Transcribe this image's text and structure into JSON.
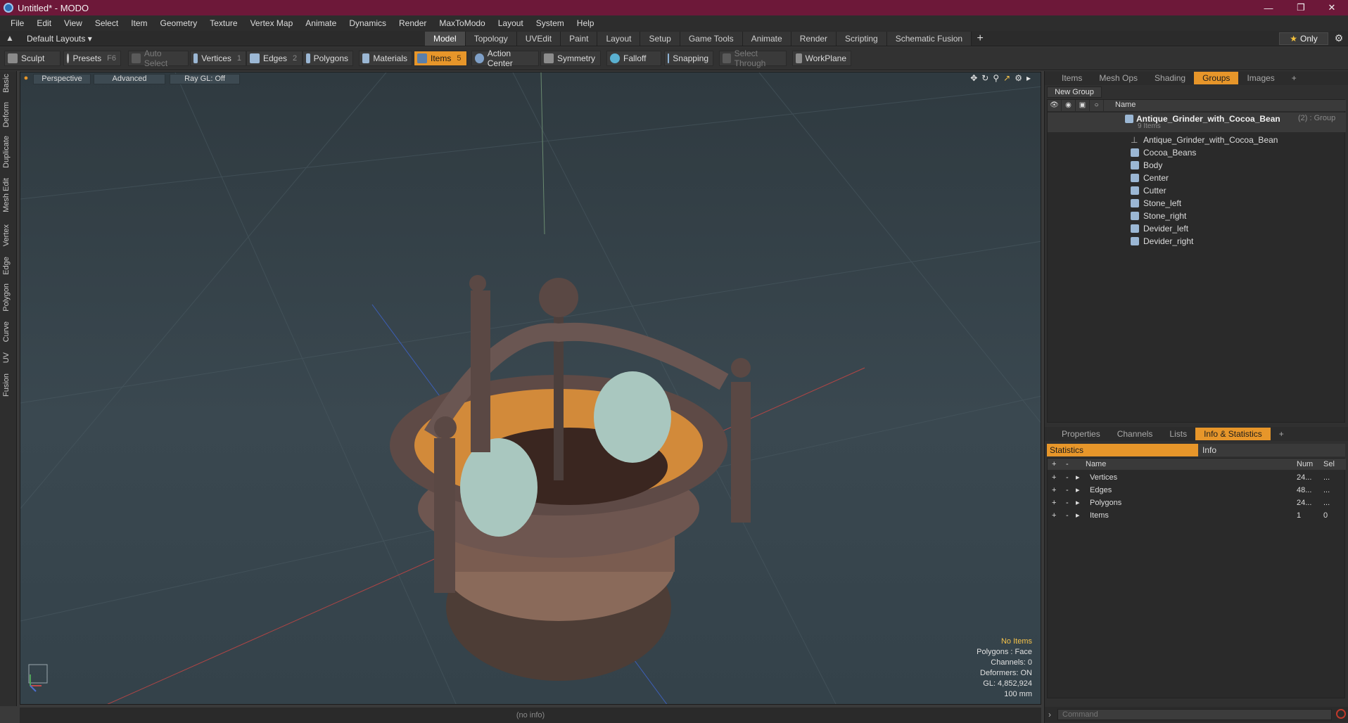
{
  "window": {
    "title": "Untitled* - MODO"
  },
  "menu": [
    "File",
    "Edit",
    "View",
    "Select",
    "Item",
    "Geometry",
    "Texture",
    "Vertex Map",
    "Animate",
    "Dynamics",
    "Render",
    "MaxToModo",
    "Layout",
    "System",
    "Help"
  ],
  "layout_bar": {
    "default_layout": "Default Layouts ▾",
    "tabs": [
      "Model",
      "Topology",
      "UVEdit",
      "Paint",
      "Layout",
      "Setup",
      "Game Tools",
      "Animate",
      "Render",
      "Scripting",
      "Schematic Fusion"
    ],
    "only_label": "Only"
  },
  "toolbar": {
    "sculpt": "Sculpt",
    "presets": "Presets",
    "presets_key": "F6",
    "auto_select": "Auto Select",
    "vertices": "Vertices",
    "vertices_key": "1",
    "edges": "Edges",
    "edges_key": "2",
    "polygons": "Polygons",
    "materials": "Materials",
    "items": "Items",
    "items_key": "5",
    "action_center": "Action Center",
    "symmetry": "Symmetry",
    "falloff": "Falloff",
    "snapping": "Snapping",
    "select_through": "Select Through",
    "workplane": "WorkPlane"
  },
  "left_tabs": [
    "Basic",
    "Deform",
    "Duplicate",
    "Mesh Edit",
    "Vertex",
    "Edge",
    "Polygon",
    "Curve",
    "UV",
    "Fusion"
  ],
  "viewport": {
    "view": "Perspective",
    "shading": "Advanced",
    "raygl": "Ray GL: Off",
    "hud": {
      "no_items": "No Items",
      "polygons": "Polygons : Face",
      "channels": "Channels: 0",
      "deformers": "Deformers: ON",
      "gl": "GL: 4,852,924",
      "units": "100 mm"
    },
    "status": "(no info)"
  },
  "groups_panel": {
    "tabs": [
      "Items",
      "Mesh Ops",
      "Shading",
      "Groups",
      "Images"
    ],
    "new_group": "New Group",
    "name_header": "Name",
    "group_name": "Antique_Grinder_with_Cocoa_Bean",
    "group_suffix": "(2) : Group",
    "item_count": "9 Items",
    "children": [
      "Antique_Grinder_with_Cocoa_Bean",
      "Cocoa_Beans",
      "Body",
      "Center",
      "Cutter",
      "Stone_left",
      "Stone_right",
      "Devider_left",
      "Devider_right"
    ]
  },
  "info_panel": {
    "tabs": [
      "Properties",
      "Channels",
      "Lists",
      "Info & Statistics"
    ],
    "statistics": "Statistics",
    "info": "Info",
    "headers": {
      "name": "Name",
      "num": "Num",
      "sel": "Sel"
    },
    "rows": [
      {
        "name": "Vertices",
        "num": "24...",
        "sel": "..."
      },
      {
        "name": "Edges",
        "num": "48...",
        "sel": "..."
      },
      {
        "name": "Polygons",
        "num": "24...",
        "sel": "..."
      },
      {
        "name": "Items",
        "num": "1",
        "sel": "0"
      }
    ]
  },
  "command": {
    "placeholder": "Command"
  }
}
